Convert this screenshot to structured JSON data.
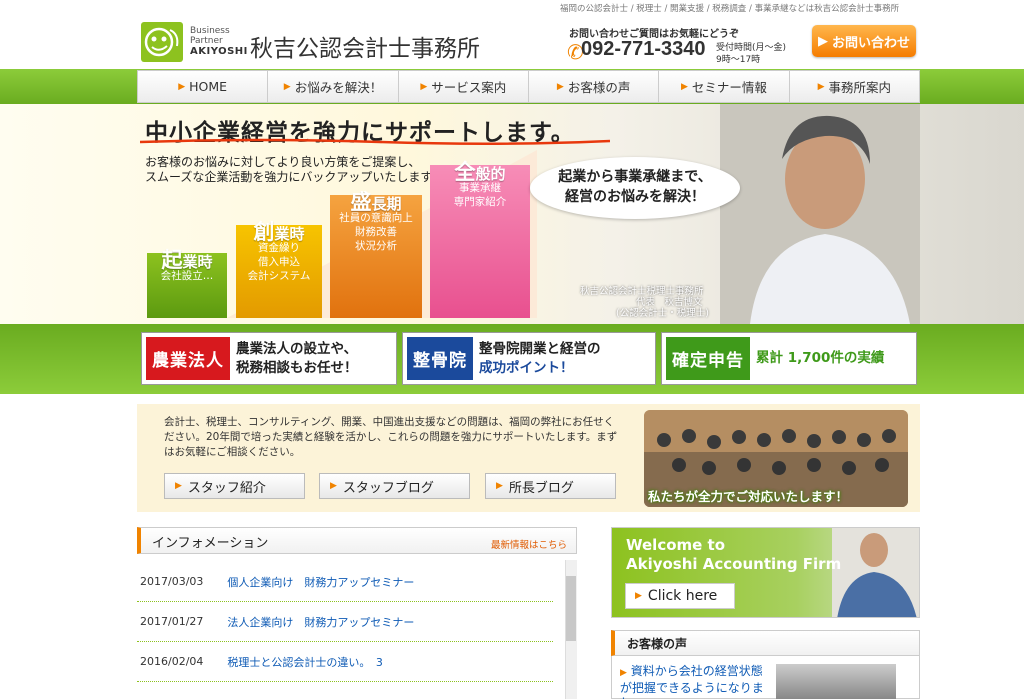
{
  "header": {
    "tagline": "福岡の公認会計士 / 税理士 / 開業支援 / 税務調査 / 事業承継などは秋吉公認会計士事務所",
    "logo": {
      "line1": "Business",
      "line2": "Partner",
      "line3": "AKIYOSHI"
    },
    "firm_name": "秋吉公認会計士事務所",
    "contact_label": "お問い合わせご質問はお気軽にどうぞ",
    "phone": "092-771-3340",
    "hours_line1": "受付時間(月～金)",
    "hours_line2": "9時～17時",
    "contact_button": "お問い合わせ"
  },
  "nav": [
    {
      "label": "HOME"
    },
    {
      "label": "お悩みを解決！"
    },
    {
      "label": "サービス案内"
    },
    {
      "label": "お客様の声"
    },
    {
      "label": "セミナー情報"
    },
    {
      "label": "事務所案内"
    }
  ],
  "hero": {
    "title": "中小企業経営を強力にサポートします。",
    "desc1": "お客様のお悩みに対してより良い方策をご提案し、",
    "desc2": "スムーズな企業活動を強力にバックアップいたします。",
    "steps": [
      {
        "big": "起",
        "rest": "業時",
        "body": [
          "会社設立…"
        ]
      },
      {
        "big": "創",
        "rest": "業時",
        "body": [
          "資金繰り",
          "借入申込",
          "会計システム"
        ]
      },
      {
        "big": "盛",
        "rest": "長期",
        "body": [
          "社員の意識向上",
          "財務改善",
          "状況分析"
        ]
      },
      {
        "big": "全",
        "rest": "般的",
        "body": [
          "事業承継",
          "専門家紹介"
        ]
      }
    ],
    "bubble1": "起業から事業承継まで、",
    "bubble2": "経営のお悩みを解決！",
    "caption1": "秋吉公認会計士税理士事務所",
    "caption2": "代表　秋吉博文",
    "caption3": "(公認会計士・税理士)"
  },
  "banners": [
    {
      "tag": "農業法人",
      "line1": "農業法人の設立や、",
      "line2": "税務相談もお任せ！",
      "color": "#d7191e"
    },
    {
      "tag": "整骨院",
      "line1": "整骨院開業と経営の",
      "line2": "成功ポイント！",
      "color": "#1b4a9c"
    },
    {
      "tag": "確定申告",
      "line1": "累計 1,700件の実績",
      "line2": "",
      "color": "#3f9a1a"
    }
  ],
  "intro": {
    "text": "会計士、税理士、コンサルティング、開業、中国進出支援などの問題は、福岡の弊社にお任せください。20年間で培った実績と経験を活かし、これらの問題を強力にサポートいたします。まずはお気軽にご相談ください。",
    "buttons": [
      "スタッフ紹介",
      "スタッフブログ",
      "所長ブログ"
    ],
    "photo_caption": "私たちが全力でご対応いたします！"
  },
  "info": {
    "title": "インフォメーション",
    "more": "最新情報はこちら",
    "items": [
      {
        "date": "2017/03/03",
        "title": "個人企業向け　財務力アップセミナー"
      },
      {
        "date": "2017/01/27",
        "title": "法人企業向け　財務力アップセミナー"
      },
      {
        "date": "2016/02/04",
        "title": "税理士と公認会計士の違い。　3"
      }
    ]
  },
  "welcome": {
    "line1": "Welcome to",
    "line2": "Akiyoshi Accounting Firm",
    "button": "Click here"
  },
  "voice": {
    "title": "お客様の声",
    "item": "資料から会社の経営状態が把握できるようになりまし"
  }
}
